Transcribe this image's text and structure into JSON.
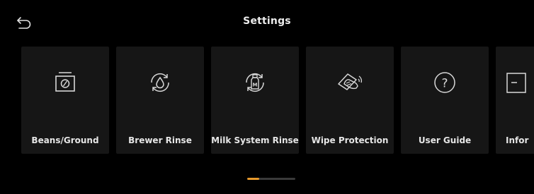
{
  "header": {
    "title": "Settings",
    "back_icon": "back-arrow-icon"
  },
  "tiles": [
    {
      "label": "Beans/Ground",
      "icon": "bean-container-icon"
    },
    {
      "label": "Brewer Rinse",
      "icon": "brewer-rinse-icon"
    },
    {
      "label": "Milk System Rinse",
      "icon": "milk-rinse-icon"
    },
    {
      "label": "Wipe Protection",
      "icon": "wipe-protection-icon"
    },
    {
      "label": "User Guide",
      "icon": "user-guide-icon"
    },
    {
      "label": "Infor",
      "icon": "information-icon"
    }
  ],
  "pager": {
    "page": 1,
    "active_fraction": 0.25,
    "active_color": "#e89a2c",
    "track_color": "#3a3a3a"
  },
  "colors": {
    "background": "#000000",
    "tile": "#161616",
    "text": "#ececec"
  }
}
